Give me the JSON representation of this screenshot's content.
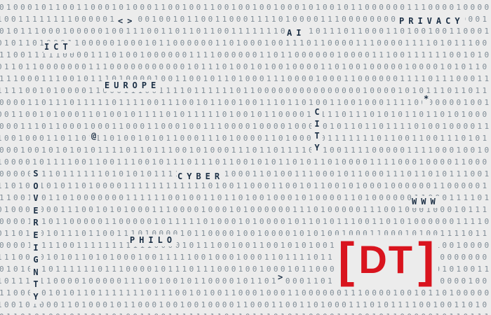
{
  "words": {
    "privacy": "PRIVACY",
    "ai": "AI",
    "ict": "ICT",
    "europe": "EUROPE",
    "city": "CITY",
    "cyber": "CYBER",
    "sovereignty": "SOVEREIGNTY",
    "philo": "PHILO",
    "www": "WWW"
  },
  "symbols": {
    "angle_pair": "<>",
    "at": "@",
    "star": "*",
    "arrow": ">"
  },
  "logo": {
    "left_bracket": "[",
    "text": "DT",
    "right_bracket": "]",
    "color": "#d9141e"
  },
  "colors": {
    "background": "#ececec",
    "digits": "#7f8c96",
    "words": "#1b2f45",
    "accent": "#d9141e"
  }
}
